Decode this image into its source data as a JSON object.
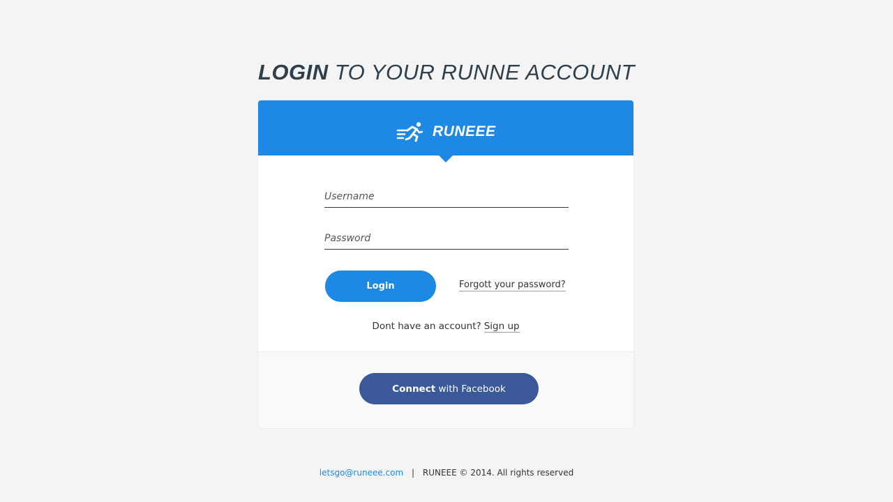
{
  "heading": {
    "strong": "LOGIN",
    "rest": "TO YOUR RUNNE ACCOUNT"
  },
  "brand": {
    "name": "RUNEEE",
    "logo_icon": "runner-icon"
  },
  "form": {
    "username_placeholder": "Username",
    "password_placeholder": "Password",
    "login_label": "Login",
    "forgot_label": "Forgott your password?",
    "signup_prompt": "Dont have an account?",
    "signup_label": "Sign up"
  },
  "social": {
    "connect_strong": "Connect",
    "connect_rest": "with Facebook"
  },
  "footer": {
    "email": "letsgo@runeee.com",
    "separator": "|",
    "copyright": "RUNEEE © 2014. All rights reserved"
  },
  "colors": {
    "accent": "#1e88e5",
    "facebook": "#3b5998",
    "background": "#f4f4f4"
  }
}
